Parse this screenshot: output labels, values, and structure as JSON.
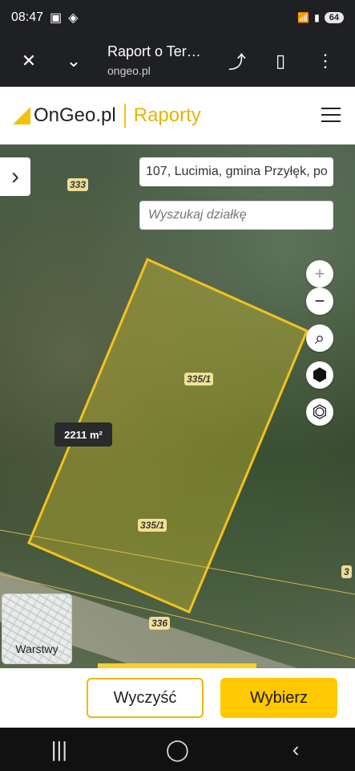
{
  "status": {
    "time": "08:47",
    "battery": "64"
  },
  "browser": {
    "title": "Raport o Ter…",
    "url": "ongeo.pl"
  },
  "header": {
    "brand": "OnGeo.pl",
    "section": "Raporty"
  },
  "map": {
    "address": "107, Lucimia, gmina Przyłęk, po",
    "search_placeholder": "Wyszukaj działkę",
    "parcel_labels": [
      "333",
      "335/1",
      "335/1",
      "336",
      "3"
    ],
    "area": "2211 m²",
    "layers_label": "Warstwy",
    "parcel_color": "#f2c21d"
  },
  "buttons": {
    "clear": "Wyczyść",
    "select": "Wybierz"
  }
}
